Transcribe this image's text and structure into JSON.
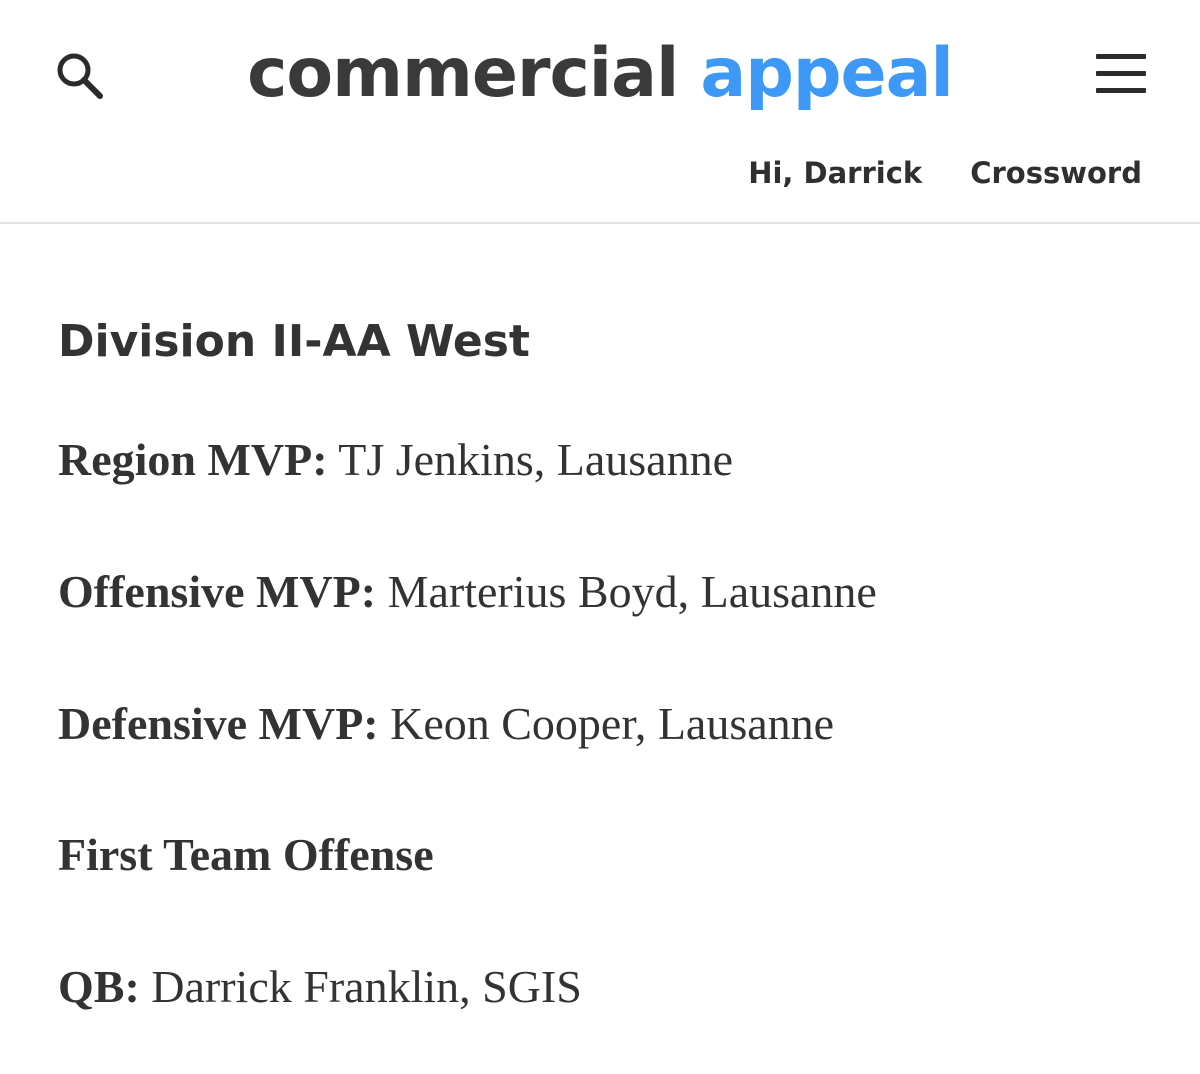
{
  "header": {
    "search_icon": "search-icon",
    "logo": {
      "word_1": "commercial",
      "word_2": "appeal",
      "accent_color": "#3d99f5"
    },
    "menu_icon": "hamburger-menu-icon",
    "greeting": "Hi, Darrick",
    "crossword_link": "Crossword"
  },
  "article": {
    "section_heading": "Division II-AA West",
    "region_mvp": {
      "label": "Region MVP:",
      "value": " TJ Jenkins, Lausanne"
    },
    "offensive_mvp": {
      "label": "Offensive MVP:",
      "value": " Marterius Boyd, Lausanne"
    },
    "defensive_mvp": {
      "label": "Defensive MVP:",
      "value": " Keon Cooper, Lausanne"
    },
    "first_team_heading": "First Team Offense",
    "qb": {
      "label": "QB:",
      "value": " Darrick Franklin, SGIS"
    }
  }
}
